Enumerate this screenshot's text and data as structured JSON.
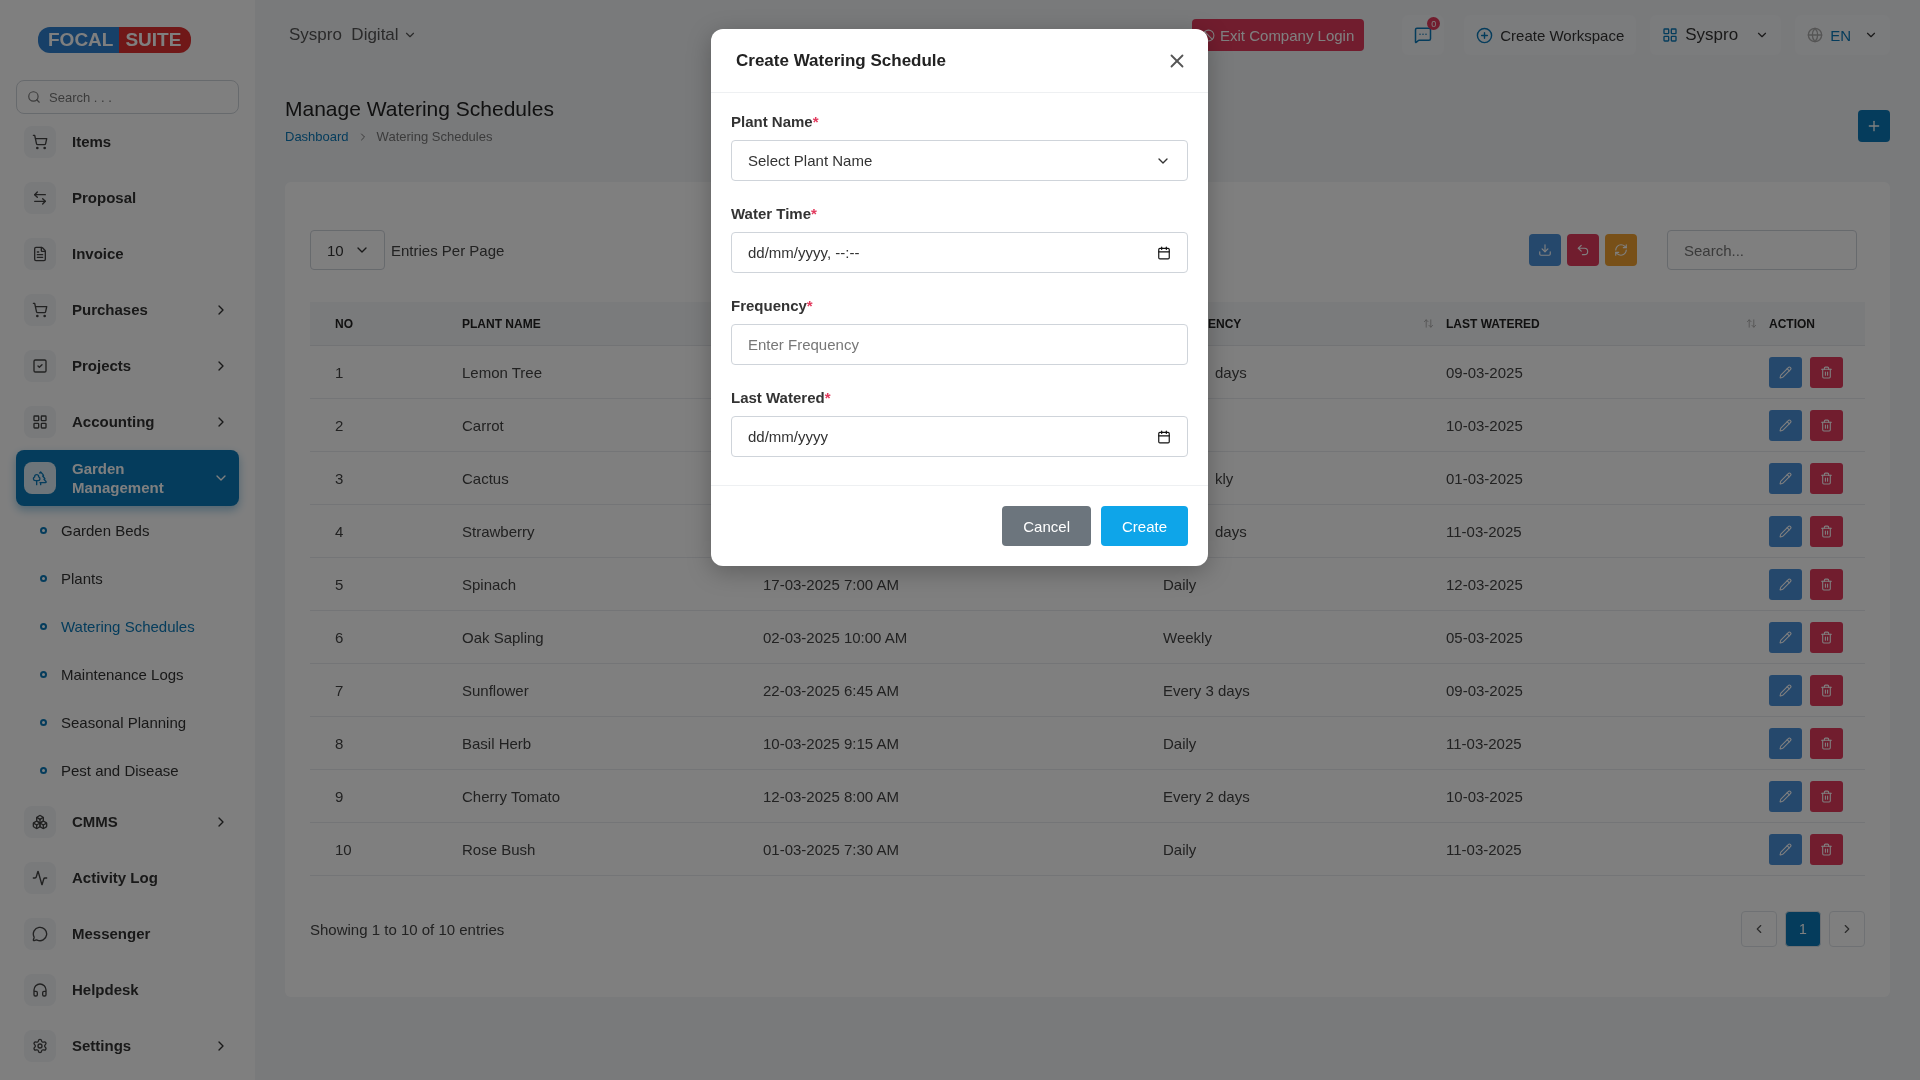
{
  "brand": {
    "logo_left": "FOCAL",
    "logo_right": "SUITE"
  },
  "sidebar": {
    "search_placeholder": "Search . . .",
    "items": [
      {
        "label": "Items",
        "selected": false
      },
      {
        "label": "Proposal",
        "selected": false
      },
      {
        "label": "Invoice",
        "selected": false
      },
      {
        "label": "Purchases",
        "selected": false,
        "expanded": false
      },
      {
        "label": "Projects",
        "selected": false,
        "expanded": false
      },
      {
        "label": "Accounting",
        "selected": false,
        "expanded": false
      },
      {
        "label": "Garden Management",
        "selected": true,
        "expanded": true,
        "children": [
          {
            "label": "Garden Beds",
            "selected": false
          },
          {
            "label": "Plants",
            "selected": false
          },
          {
            "label": "Watering Schedules",
            "selected": true
          },
          {
            "label": "Maintenance Logs",
            "selected": false
          },
          {
            "label": "Seasonal Planning",
            "selected": false
          },
          {
            "label": "Pest and Disease",
            "selected": false
          }
        ]
      },
      {
        "label": "CMMS",
        "selected": false,
        "expanded": false
      },
      {
        "label": "Activity Log",
        "selected": false
      },
      {
        "label": "Messenger",
        "selected": false
      },
      {
        "label": "Helpdesk",
        "selected": false
      },
      {
        "label": "Settings",
        "selected": false,
        "expanded": false
      }
    ]
  },
  "header": {
    "workspace": "Syspro  Digital",
    "exit_button": "Exit Company Login",
    "chat_badge": "0",
    "create_workspace": "Create Workspace",
    "user": "Syspro",
    "language": "EN"
  },
  "page": {
    "title": "Manage Watering Schedules",
    "breadcrumb": [
      {
        "label": "Dashboard",
        "kind": "link"
      },
      {
        "label": "Watering Schedules",
        "kind": "current"
      }
    ]
  },
  "table": {
    "per_page": "10",
    "per_page_label": "Entries Per Page",
    "search_placeholder": "Search...",
    "columns": [
      {
        "label": "NO"
      },
      {
        "label": "PLANT NAME"
      },
      {},
      {
        "label": "ENCY",
        "clipped": true,
        "sortable": true
      },
      {
        "label": "LAST WATERED",
        "sortable": true
      },
      {
        "label": "ACTION"
      }
    ],
    "rows": [
      {
        "no": "1",
        "plant": "Lemon Tree",
        "frequency": "days",
        "frequency_clipped": true,
        "last_watered": "09-03-2025"
      },
      {
        "no": "2",
        "plant": "Carrot",
        "last_watered": "10-03-2025"
      },
      {
        "no": "3",
        "plant": "Cactus",
        "frequency": "kly",
        "frequency_clipped": true,
        "last_watered": "01-03-2025"
      },
      {
        "no": "4",
        "plant": "Strawberry",
        "frequency": "days",
        "frequency_clipped": true,
        "last_watered": "11-03-2025"
      },
      {
        "no": "5",
        "plant": "Spinach",
        "water_time": "17-03-2025 7:00 AM",
        "frequency": "Daily",
        "last_watered": "12-03-2025"
      },
      {
        "no": "6",
        "plant": "Oak Sapling",
        "water_time": "02-03-2025 10:00 AM",
        "frequency": "Weekly",
        "last_watered": "05-03-2025"
      },
      {
        "no": "7",
        "plant": "Sunflower",
        "water_time": "22-03-2025 6:45 AM",
        "frequency": "Every 3 days",
        "last_watered": "09-03-2025"
      },
      {
        "no": "8",
        "plant": "Basil Herb",
        "water_time": "10-03-2025 9:15 AM",
        "frequency": "Daily",
        "last_watered": "11-03-2025"
      },
      {
        "no": "9",
        "plant": "Cherry Tomato",
        "water_time": "12-03-2025 8:00 AM",
        "frequency": "Every 2 days",
        "last_watered": "10-03-2025"
      },
      {
        "no": "10",
        "plant": "Rose Bush",
        "water_time": "01-03-2025 7:30 AM",
        "frequency": "Daily",
        "last_watered": "11-03-2025"
      }
    ],
    "summary": "Showing 1 to 10 of 10 entries",
    "pages": [
      {
        "label": "1",
        "selected": true
      }
    ]
  },
  "modal": {
    "title": "Create Watering Schedule",
    "fields": [
      {
        "label": "Plant Name",
        "required_mark": "*",
        "kind": "select",
        "placeholder": "Select Plant Name"
      },
      {
        "label": "Water Time",
        "required_mark": "*",
        "kind": "datetime",
        "placeholder": "dd/mm/yyyy, --:--"
      },
      {
        "label": "Frequency",
        "required_mark": "*",
        "kind": "text",
        "placeholder": "Enter Frequency"
      },
      {
        "label": "Last Watered",
        "required_mark": "*",
        "kind": "date",
        "placeholder": "dd/mm/yyyy"
      }
    ],
    "buttons": [
      {
        "label": "Cancel",
        "kind": "secondary"
      },
      {
        "label": "Create",
        "kind": "primary"
      }
    ]
  }
}
